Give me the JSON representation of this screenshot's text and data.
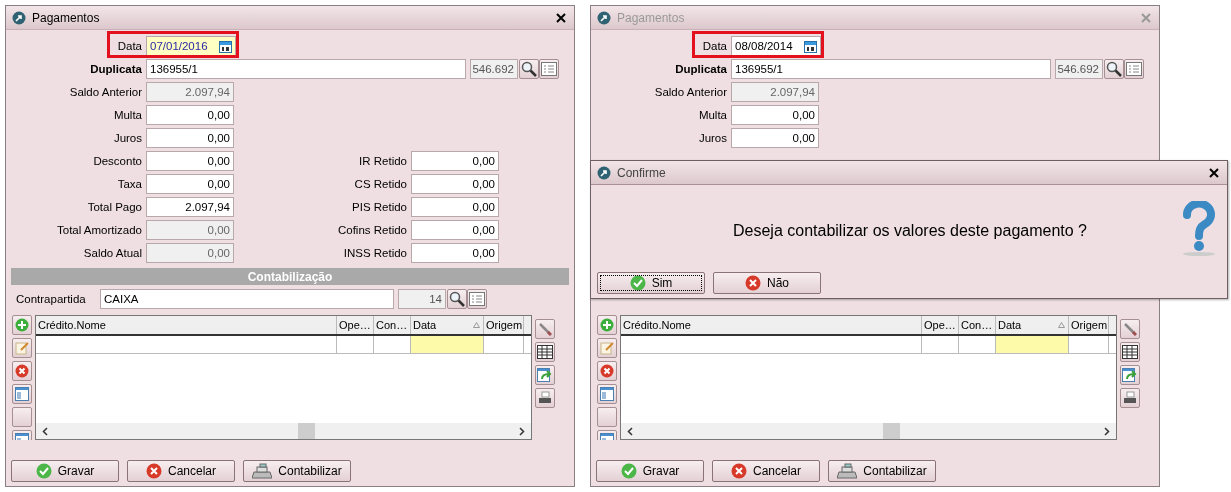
{
  "windows": [
    {
      "title": "Pagamentos",
      "active": true,
      "date": {
        "label": "Data",
        "value": "07/01/2016",
        "focused": true,
        "highlighted": true
      },
      "duplicata": {
        "label": "Duplicata",
        "value": "136955/1",
        "code": "546.692"
      },
      "form_rows": [
        {
          "cells": [
            {
              "label": "Saldo Anterior",
              "value": "2.097,94",
              "readonly": true
            }
          ]
        },
        {
          "cells": [
            {
              "label": "Multa",
              "value": "0,00",
              "readonly": false
            }
          ]
        },
        {
          "cells": [
            {
              "label": "Juros",
              "value": "0,00",
              "readonly": false
            }
          ]
        },
        {
          "cells": [
            {
              "label": "Desconto",
              "value": "0,00",
              "readonly": false
            },
            {
              "label": "IR Retido",
              "value": "0,00",
              "readonly": false
            }
          ]
        },
        {
          "cells": [
            {
              "label": "Taxa",
              "value": "0,00",
              "readonly": false
            },
            {
              "label": "CS Retido",
              "value": "0,00",
              "readonly": false
            }
          ]
        },
        {
          "cells": [
            {
              "label": "Total Pago",
              "value": "2.097,94",
              "readonly": false
            },
            {
              "label": "PIS Retido",
              "value": "0,00",
              "readonly": false
            }
          ]
        },
        {
          "cells": [
            {
              "label": "Total Amortizado",
              "value": "0,00",
              "readonly": true
            },
            {
              "label": "Cofins Retido",
              "value": "0,00",
              "readonly": false
            }
          ]
        },
        {
          "cells": [
            {
              "label": "Saldo Atual",
              "value": "0,00",
              "readonly": true
            },
            {
              "label": "INSS Retido",
              "value": "0,00",
              "readonly": false
            }
          ]
        }
      ],
      "section": "Contabilização",
      "contrapartida": {
        "label": "Contrapartida",
        "value": "CAIXA",
        "code": "14"
      },
      "grid": {
        "columns": [
          {
            "label": "Crédito.Nome",
            "sorted": false,
            "highlighted": false
          },
          {
            "label": "Ope…",
            "sorted": false,
            "highlighted": false
          },
          {
            "label": "Con…",
            "sorted": false,
            "highlighted": false
          },
          {
            "label": "Data",
            "sorted": true,
            "highlighted": true
          },
          {
            "label": "Origem",
            "sorted": false,
            "highlighted": false
          }
        ]
      },
      "buttons": [
        {
          "label": "Gravar",
          "kind": "check"
        },
        {
          "label": "Cancelar",
          "kind": "cross"
        },
        {
          "label": "Contabilizar",
          "kind": "register"
        }
      ]
    },
    {
      "title": "Pagamentos",
      "active": false,
      "date": {
        "label": "Data",
        "value": "08/08/2014",
        "focused": false,
        "highlighted": true
      },
      "duplicata": {
        "label": "Duplicata",
        "value": "136955/1",
        "code": "546.692"
      },
      "form_rows": [
        {
          "cells": [
            {
              "label": "Saldo Anterior",
              "value": "2.097,94",
              "readonly": true
            }
          ]
        },
        {
          "cells": [
            {
              "label": "Multa",
              "value": "0,00",
              "readonly": false
            }
          ]
        },
        {
          "cells": [
            {
              "label": "Juros",
              "value": "0,00",
              "readonly": false
            }
          ]
        }
      ],
      "grid": {
        "columns": [
          {
            "label": "Crédito.Nome",
            "sorted": false,
            "highlighted": false
          },
          {
            "label": "Ope…",
            "sorted": false,
            "highlighted": false
          },
          {
            "label": "Con…",
            "sorted": false,
            "highlighted": false
          },
          {
            "label": "Data",
            "sorted": true,
            "highlighted": true
          },
          {
            "label": "Origem",
            "sorted": false,
            "highlighted": false
          }
        ]
      },
      "buttons": [
        {
          "label": "Gravar",
          "kind": "check"
        },
        {
          "label": "Cancelar",
          "kind": "cross"
        },
        {
          "label": "Contabilizar",
          "kind": "register"
        }
      ]
    }
  ],
  "dialog": {
    "title": "Confirme",
    "message": "Deseja contabilizar os valores deste pagamento ?",
    "buttons": [
      {
        "label": "Sim",
        "kind": "check",
        "default": true
      },
      {
        "label": "Não",
        "kind": "cross",
        "default": false
      }
    ]
  }
}
